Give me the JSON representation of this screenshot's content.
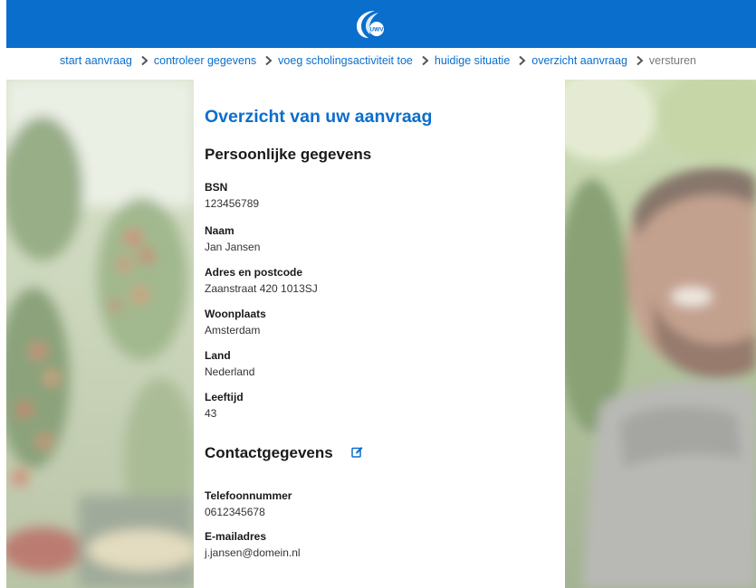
{
  "header": {
    "brand_color": "#0a6ecd",
    "logo_text": "UWV"
  },
  "breadcrumb": {
    "items": [
      {
        "label": "start aanvraag"
      },
      {
        "label": "controleer gegevens"
      },
      {
        "label": "voeg scholingsactiviteit toe"
      },
      {
        "label": "huidige situatie"
      },
      {
        "label": "overzicht aanvraag"
      },
      {
        "label": "versturen"
      }
    ],
    "separator_icon": "chevron-right-icon"
  },
  "main": {
    "title": "Overzicht van uw aanvraag",
    "personal": {
      "heading": "Persoonlijke gegevens",
      "fields": [
        {
          "label": "BSN",
          "value": "123456789"
        },
        {
          "label": "Naam",
          "value": "Jan Jansen"
        },
        {
          "label": "Adres en postcode",
          "value": "Zaanstraat 420 1013SJ"
        },
        {
          "label": "Woonplaats",
          "value": "Amsterdam"
        },
        {
          "label": "Land",
          "value": "Nederland"
        },
        {
          "label": "Leeftijd",
          "value": "43"
        }
      ]
    },
    "contact": {
      "heading": "Contactgegevens",
      "edit_icon": "edit-icon",
      "fields": [
        {
          "label": "Telefoonnummer",
          "value": "0612345678"
        },
        {
          "label": "E-mailadres",
          "value": "j.jansen@domein.nl"
        }
      ]
    }
  }
}
